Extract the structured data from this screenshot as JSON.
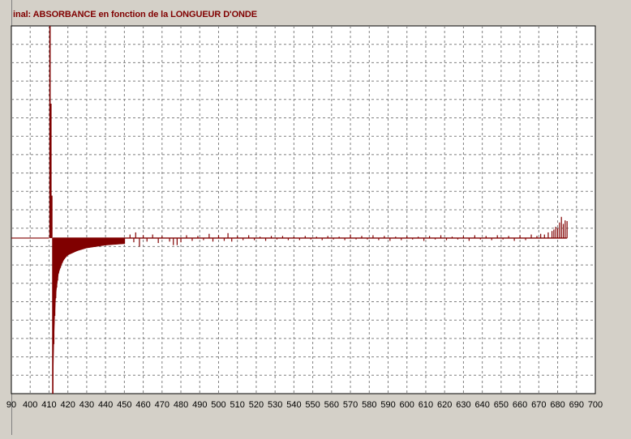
{
  "window": {
    "title": "inal: ABSORBANCE en fonction de la LONGUEUR D'ONDE"
  },
  "colors": {
    "series": "#800000",
    "plot_bg": "#ffffff",
    "frame_bg": "#d4d0c8",
    "grid": "#808080"
  },
  "chart_data": {
    "type": "bar",
    "title": "inal: ABSORBANCE en fonction de la LONGUEUR D'ONDE",
    "xlabel": "",
    "ylabel": "",
    "x_ticks": [
      "90",
      "400",
      "410",
      "420",
      "430",
      "440",
      "450",
      "460",
      "470",
      "480",
      "490",
      "500",
      "510",
      "520",
      "530",
      "540",
      "550",
      "560",
      "570",
      "580",
      "590",
      "600",
      "610",
      "620",
      "630",
      "640",
      "650",
      "660",
      "670",
      "680",
      "690",
      "700"
    ],
    "xlim": [
      390,
      700
    ],
    "ylim": [
      -2.2,
      3.0
    ],
    "grid": true,
    "legend": "none",
    "series": [
      {
        "baseline": 0,
        "segment": [
          {
            "x": 390,
            "y": 0
          },
          {
            "x": 410,
            "y": 0
          },
          {
            "x": 410.5,
            "y": 3.0
          },
          {
            "x": 411,
            "y": 1.9
          },
          {
            "x": 411.5,
            "y": 0.6
          },
          {
            "x": 412,
            "y": -2.2
          },
          {
            "x": 412.5,
            "y": -1.5
          },
          {
            "x": 413,
            "y": -1.1
          },
          {
            "x": 413.5,
            "y": -0.85
          },
          {
            "x": 414,
            "y": -0.7
          },
          {
            "x": 414.5,
            "y": -0.6
          },
          {
            "x": 415,
            "y": -0.5
          },
          {
            "x": 416,
            "y": -0.42
          },
          {
            "x": 417,
            "y": -0.35
          },
          {
            "x": 418,
            "y": -0.3
          },
          {
            "x": 420,
            "y": -0.24
          },
          {
            "x": 425,
            "y": -0.18
          },
          {
            "x": 430,
            "y": -0.14
          },
          {
            "x": 440,
            "y": -0.1
          },
          {
            "x": 450,
            "y": -0.08
          }
        ],
        "spikes": [
          {
            "x": 453,
            "y": 0.05
          },
          {
            "x": 455,
            "y": -0.06
          },
          {
            "x": 456,
            "y": 0.08
          },
          {
            "x": 458,
            "y": -0.12
          },
          {
            "x": 460,
            "y": 0.04
          },
          {
            "x": 462,
            "y": -0.05
          },
          {
            "x": 465,
            "y": 0.05
          },
          {
            "x": 468,
            "y": -0.07
          },
          {
            "x": 470,
            "y": 0.03
          },
          {
            "x": 474,
            "y": -0.05
          },
          {
            "x": 476,
            "y": -0.1
          },
          {
            "x": 478,
            "y": -0.1
          },
          {
            "x": 480,
            "y": -0.06
          },
          {
            "x": 483,
            "y": 0.04
          },
          {
            "x": 486,
            "y": -0.04
          },
          {
            "x": 489,
            "y": 0.03
          },
          {
            "x": 492,
            "y": -0.03
          },
          {
            "x": 495,
            "y": 0.06
          },
          {
            "x": 497,
            "y": -0.05
          },
          {
            "x": 500,
            "y": 0.04
          },
          {
            "x": 503,
            "y": -0.04
          },
          {
            "x": 505,
            "y": 0.07
          },
          {
            "x": 507,
            "y": -0.05
          },
          {
            "x": 510,
            "y": 0.03
          },
          {
            "x": 513,
            "y": -0.03
          },
          {
            "x": 516,
            "y": 0.04
          },
          {
            "x": 519,
            "y": -0.03
          },
          {
            "x": 522,
            "y": 0.02
          },
          {
            "x": 525,
            "y": -0.04
          },
          {
            "x": 528,
            "y": 0.03
          },
          {
            "x": 531,
            "y": -0.02
          },
          {
            "x": 534,
            "y": 0.03
          },
          {
            "x": 537,
            "y": -0.03
          },
          {
            "x": 540,
            "y": 0.02
          },
          {
            "x": 543,
            "y": -0.03
          },
          {
            "x": 546,
            "y": 0.03
          },
          {
            "x": 549,
            "y": -0.02
          },
          {
            "x": 552,
            "y": 0.02
          },
          {
            "x": 555,
            "y": -0.03
          },
          {
            "x": 558,
            "y": 0.03
          },
          {
            "x": 561,
            "y": -0.02
          },
          {
            "x": 564,
            "y": 0.02
          },
          {
            "x": 567,
            "y": -0.03
          },
          {
            "x": 570,
            "y": 0.05
          },
          {
            "x": 573,
            "y": -0.02
          },
          {
            "x": 576,
            "y": 0.03
          },
          {
            "x": 579,
            "y": -0.02
          },
          {
            "x": 582,
            "y": 0.04
          },
          {
            "x": 585,
            "y": -0.03
          },
          {
            "x": 588,
            "y": 0.03
          },
          {
            "x": 591,
            "y": -0.04
          },
          {
            "x": 594,
            "y": 0.02
          },
          {
            "x": 597,
            "y": -0.03
          },
          {
            "x": 600,
            "y": 0.03
          },
          {
            "x": 603,
            "y": -0.02
          },
          {
            "x": 606,
            "y": 0.02
          },
          {
            "x": 609,
            "y": -0.04
          },
          {
            "x": 612,
            "y": 0.03
          },
          {
            "x": 615,
            "y": -0.02
          },
          {
            "x": 618,
            "y": 0.04
          },
          {
            "x": 621,
            "y": -0.03
          },
          {
            "x": 624,
            "y": 0.02
          },
          {
            "x": 627,
            "y": -0.02
          },
          {
            "x": 630,
            "y": 0.03
          },
          {
            "x": 633,
            "y": -0.04
          },
          {
            "x": 636,
            "y": 0.04
          },
          {
            "x": 639,
            "y": -0.02
          },
          {
            "x": 642,
            "y": 0.03
          },
          {
            "x": 645,
            "y": -0.03
          },
          {
            "x": 648,
            "y": 0.04
          },
          {
            "x": 651,
            "y": -0.02
          },
          {
            "x": 654,
            "y": 0.03
          },
          {
            "x": 657,
            "y": -0.04
          },
          {
            "x": 660,
            "y": 0.04
          },
          {
            "x": 663,
            "y": -0.03
          },
          {
            "x": 666,
            "y": 0.05
          },
          {
            "x": 669,
            "y": 0.03
          },
          {
            "x": 671,
            "y": 0.06
          },
          {
            "x": 673,
            "y": 0.05
          },
          {
            "x": 675,
            "y": 0.08
          },
          {
            "x": 677,
            "y": 0.1
          },
          {
            "x": 678,
            "y": 0.12
          },
          {
            "x": 679,
            "y": 0.16
          },
          {
            "x": 680,
            "y": 0.14
          },
          {
            "x": 681,
            "y": 0.22
          },
          {
            "x": 682,
            "y": 0.3
          },
          {
            "x": 683,
            "y": 0.2
          },
          {
            "x": 684,
            "y": 0.25
          },
          {
            "x": 685,
            "y": 0.24
          }
        ]
      }
    ]
  }
}
